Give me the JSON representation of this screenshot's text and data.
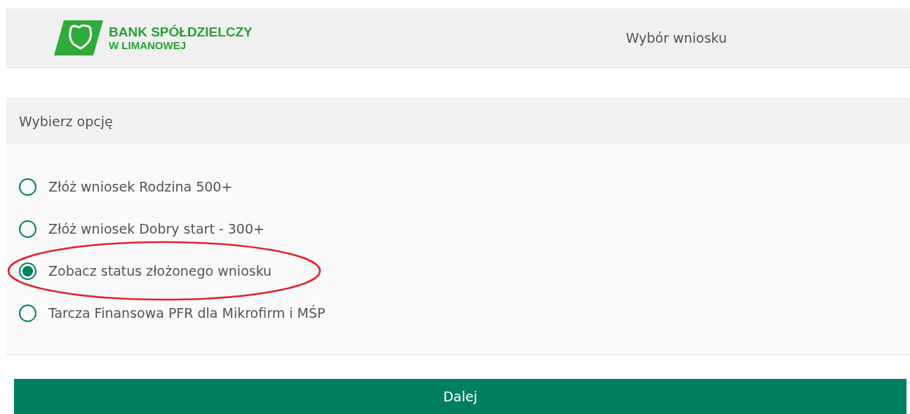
{
  "header": {
    "logo_line_1": "BANK SPÓŁDZIELCZY",
    "logo_line_2": "W LIMANOWEJ",
    "title": "Wybór wniosku"
  },
  "panel": {
    "heading": "Wybierz opcję",
    "options": [
      {
        "label": "Złóż wniosek Rodzina 500+",
        "selected": false,
        "circled": false
      },
      {
        "label": "Złóż wniosek Dobry start - 300+",
        "selected": false,
        "circled": false
      },
      {
        "label": "Zobacz status złożonego wniosku",
        "selected": true,
        "circled": true
      },
      {
        "label": "Tarcza Finansowa PFR dla Mikrofirm i MŚP",
        "selected": false,
        "circled": false
      }
    ]
  },
  "button": "Dalej"
}
